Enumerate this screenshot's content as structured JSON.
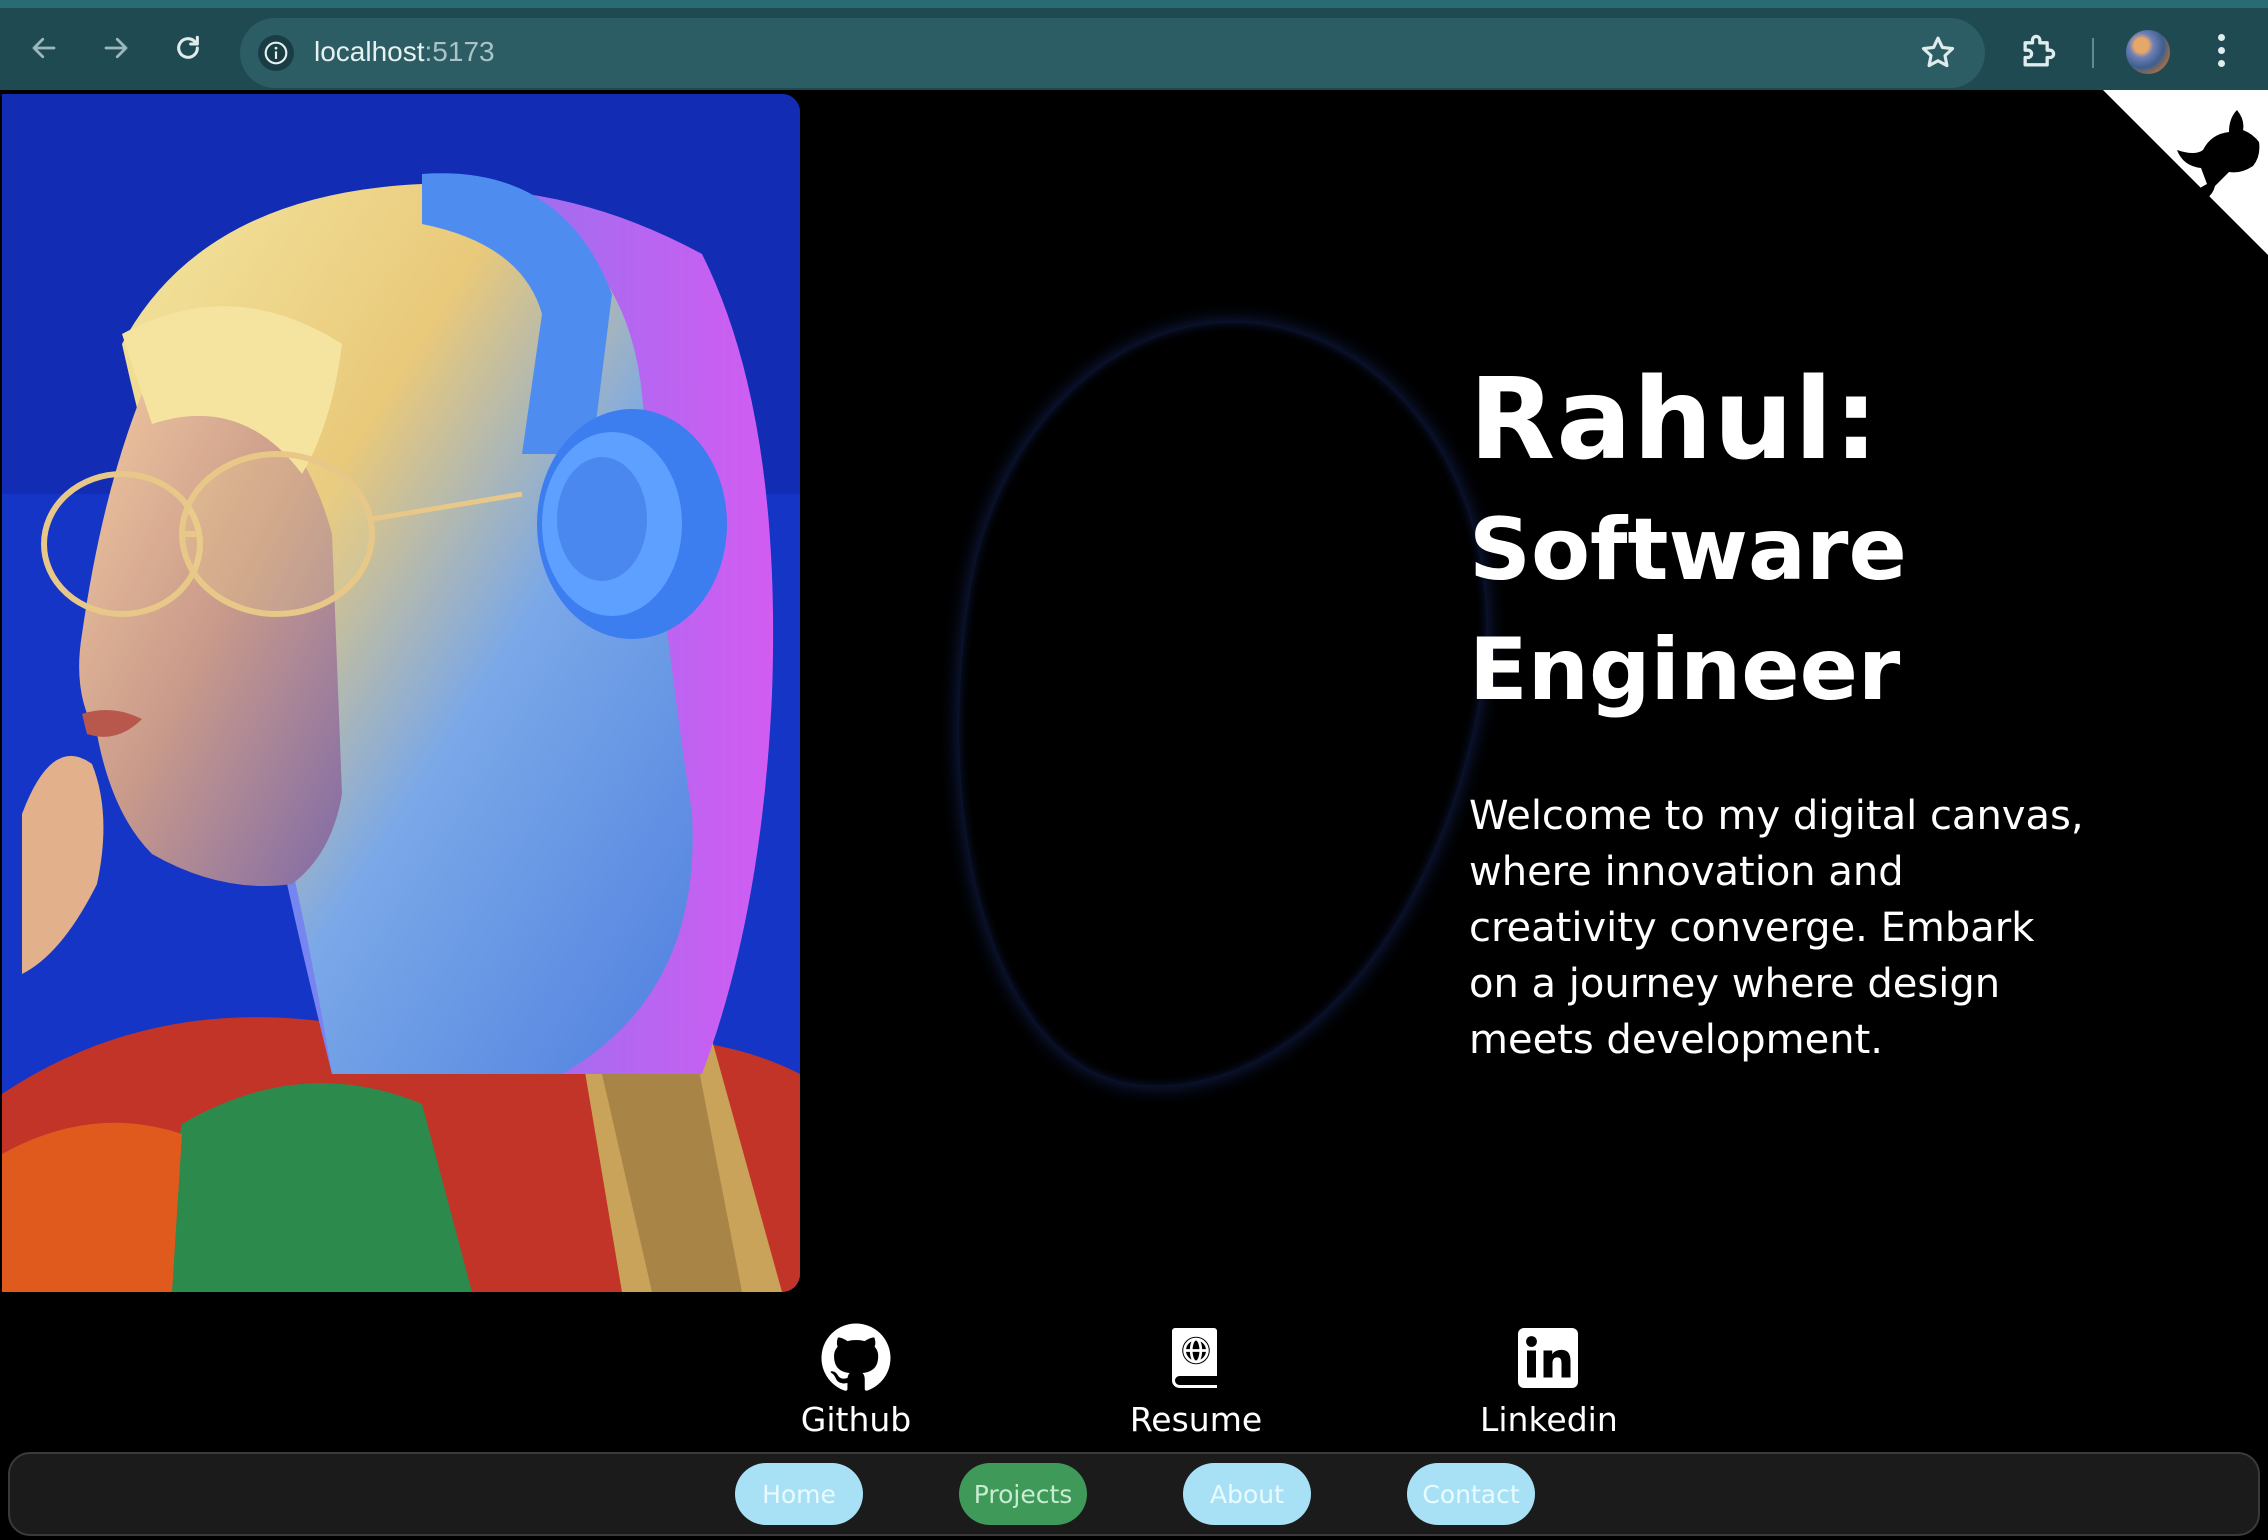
{
  "browser": {
    "url_host": "localhost",
    "url_port": ":5173"
  },
  "hero": {
    "name": "Rahul:",
    "role": "Software Engineer",
    "description": "Welcome to my digital canvas, where innovation and creativity converge. Embark on a journey where design meets development."
  },
  "socials": [
    {
      "label": "Github",
      "icon": "github-icon"
    },
    {
      "label": "Resume",
      "icon": "book-globe-icon"
    },
    {
      "label": "Linkedin",
      "icon": "linkedin-icon"
    }
  ],
  "navbar": {
    "items": [
      {
        "label": "Home"
      },
      {
        "label": "Projects"
      },
      {
        "label": "About"
      },
      {
        "label": "Contact"
      }
    ]
  },
  "colors": {
    "chrome_bg": "#1f4a51",
    "page_bg": "#000000",
    "pill_light": "#a8e1f5",
    "pill_active": "#3f9a5a"
  }
}
